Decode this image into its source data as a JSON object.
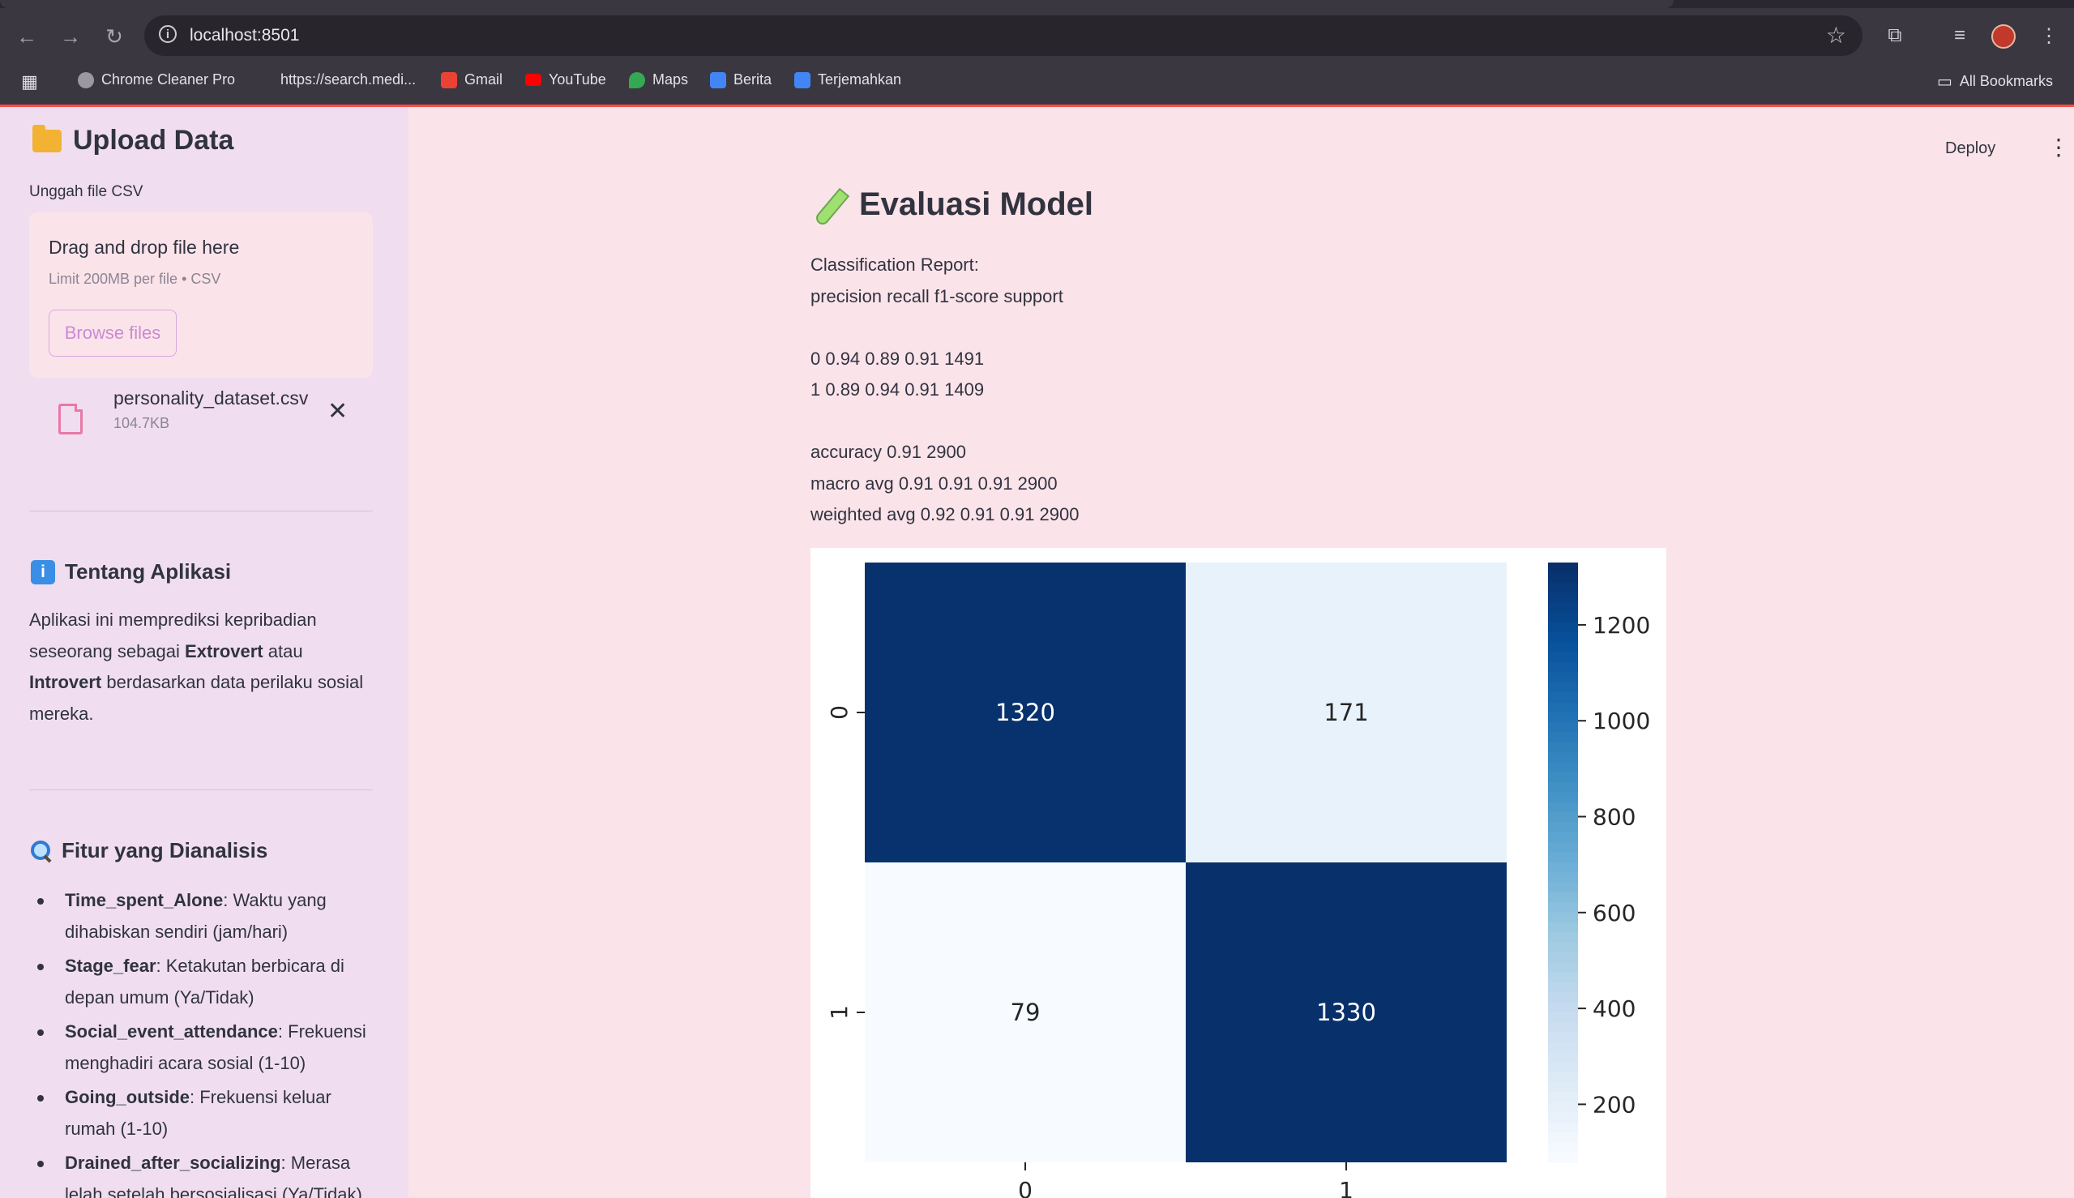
{
  "browser": {
    "url": "localhost:8501",
    "bookmarks": [
      {
        "label": "Chrome Cleaner Pro",
        "icon": "chrome-cleaner-icon"
      },
      {
        "label": "https://search.medi...",
        "icon": "none"
      },
      {
        "label": "Gmail",
        "icon": "gmail-icon"
      },
      {
        "label": "YouTube",
        "icon": "youtube-icon"
      },
      {
        "label": "Maps",
        "icon": "maps-icon"
      },
      {
        "label": "Berita",
        "icon": "news-icon"
      },
      {
        "label": "Terjemahkan",
        "icon": "translate-icon"
      }
    ],
    "all_bookmarks": "All Bookmarks"
  },
  "sidebar": {
    "upload_title": "Upload Data",
    "upload_label": "Unggah file CSV",
    "dropzone_title": "Drag and drop file here",
    "dropzone_limit": "Limit 200MB per file • CSV",
    "browse_button": "Browse files",
    "file": {
      "name": "personality_dataset.csv",
      "size": "104.7KB"
    },
    "about_title": "Tentang Aplikasi",
    "about_text": {
      "p1": "Aplikasi ini memprediksi kepribadian seseorang sebagai ",
      "b1": "Extrovert",
      "p2": " atau ",
      "b2": "Introvert",
      "p3": " berdasarkan data perilaku sosial mereka."
    },
    "features_title": "Fitur yang Dianalisis",
    "features": [
      {
        "name": "Time_spent_Alone",
        "desc": ": Waktu yang dihabiskan sendiri (jam/hari)"
      },
      {
        "name": "Stage_fear",
        "desc": ": Ketakutan berbicara di depan umum (Ya/Tidak)"
      },
      {
        "name": "Social_event_attendance",
        "desc": ": Frekuensi menghadiri acara sosial (1-10)"
      },
      {
        "name": "Going_outside",
        "desc": ": Frekuensi keluar rumah (1-10)"
      },
      {
        "name": "Drained_after_socializing",
        "desc": ": Merasa lelah setelah bersosialisasi (Ya/Tidak)"
      }
    ]
  },
  "header": {
    "deploy": "Deploy"
  },
  "main": {
    "title": "Evaluasi Model",
    "report_lines": [
      "Classification Report:",
      "precision recall f1-score support",
      "",
      "0 0.94 0.89 0.91 1491",
      "1 0.89 0.94 0.91 1409",
      "",
      "accuracy 0.91 2900",
      "macro avg 0.91 0.91 0.91 2900",
      "weighted avg 0.92 0.91 0.91 2900"
    ]
  },
  "chart_data": {
    "type": "heatmap",
    "x_categories": [
      "0",
      "1"
    ],
    "y_categories": [
      "0",
      "1"
    ],
    "values": [
      [
        1320,
        171
      ],
      [
        79,
        1330
      ]
    ],
    "colorbar_ticks": [
      200,
      400,
      600,
      800,
      1000,
      1200
    ],
    "colorbar_range": [
      79,
      1330
    ],
    "colormap": "Blues",
    "title": "",
    "xlabel": "",
    "ylabel": ""
  }
}
